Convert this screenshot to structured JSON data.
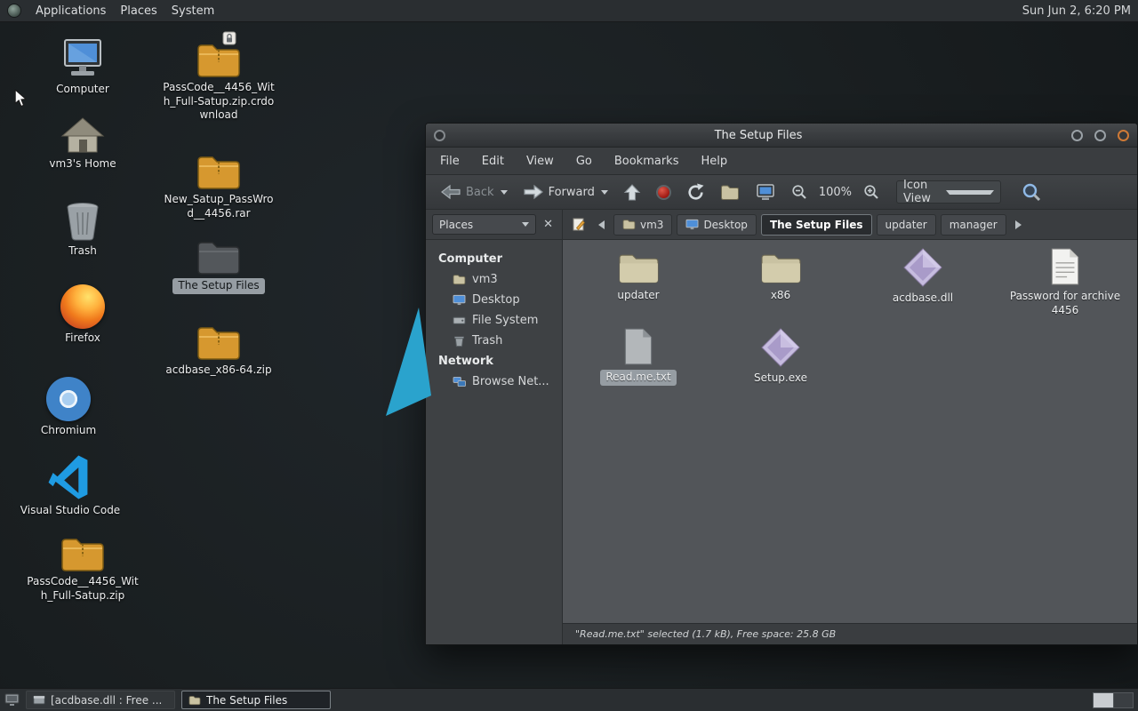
{
  "panel": {
    "menu_applications": "Applications",
    "menu_places": "Places",
    "menu_system": "System",
    "clock": "Sun Jun 2, 6:20 PM"
  },
  "desktop": {
    "icons": [
      {
        "label": "Computer",
        "icon": "computer"
      },
      {
        "label": "PassCode__4456_With_Full-Satup.zip.crdownload",
        "icon": "archive",
        "emblem": "lock"
      },
      {
        "label": "vm3's Home",
        "icon": "home-folder"
      },
      {
        "label": "New_Satup_PassWrod__4456.rar",
        "icon": "archive"
      },
      {
        "label": "Trash",
        "icon": "trash"
      },
      {
        "label": "The Setup Files",
        "icon": "folder",
        "selected": true
      },
      {
        "label": "Firefox",
        "icon": "firefox"
      },
      {
        "label": "acdbase_x86-64.zip",
        "icon": "archive"
      },
      {
        "label": "Chromium",
        "icon": "chromium"
      },
      {
        "label": "Visual Studio Code",
        "icon": "vscode"
      },
      {
        "label": "PassCode__4456_With_Full-Satup.zip",
        "icon": "archive"
      }
    ]
  },
  "window": {
    "title": "The Setup Files",
    "menubar": {
      "file": "File",
      "edit": "Edit",
      "view": "View",
      "go": "Go",
      "bookmarks": "Bookmarks",
      "help": "Help"
    },
    "toolbar": {
      "back_label": "Back",
      "forward_label": "Forward",
      "zoom_level": "100%",
      "view_mode": "Icon View"
    },
    "pathbar": {
      "crumbs": [
        "vm3",
        "Desktop",
        "The Setup Files",
        "updater",
        "manager"
      ]
    },
    "sidebar": {
      "pane_selector": "Places",
      "group_computer": "Computer",
      "items": [
        "vm3",
        "Desktop",
        "File System",
        "Trash"
      ],
      "group_network": "Network",
      "network_items": [
        "Browse Net..."
      ]
    },
    "files": [
      {
        "name": "updater",
        "icon": "folder"
      },
      {
        "name": "x86",
        "icon": "folder"
      },
      {
        "name": "acdbase.dll",
        "icon": "library"
      },
      {
        "name": "Password for archive 4456",
        "icon": "text-file"
      },
      {
        "name": "Read.me.txt",
        "icon": "text-file-gray",
        "selected": true
      },
      {
        "name": "Setup.exe",
        "icon": "executable"
      }
    ],
    "status": "\"Read.me.txt\" selected (1.7 kB), Free space: 25.8 GB"
  },
  "taskbar": {
    "tasks": [
      {
        "label": "[acdbase.dll : Free ..."
      },
      {
        "label": "The Setup Files",
        "active": true
      }
    ]
  }
}
